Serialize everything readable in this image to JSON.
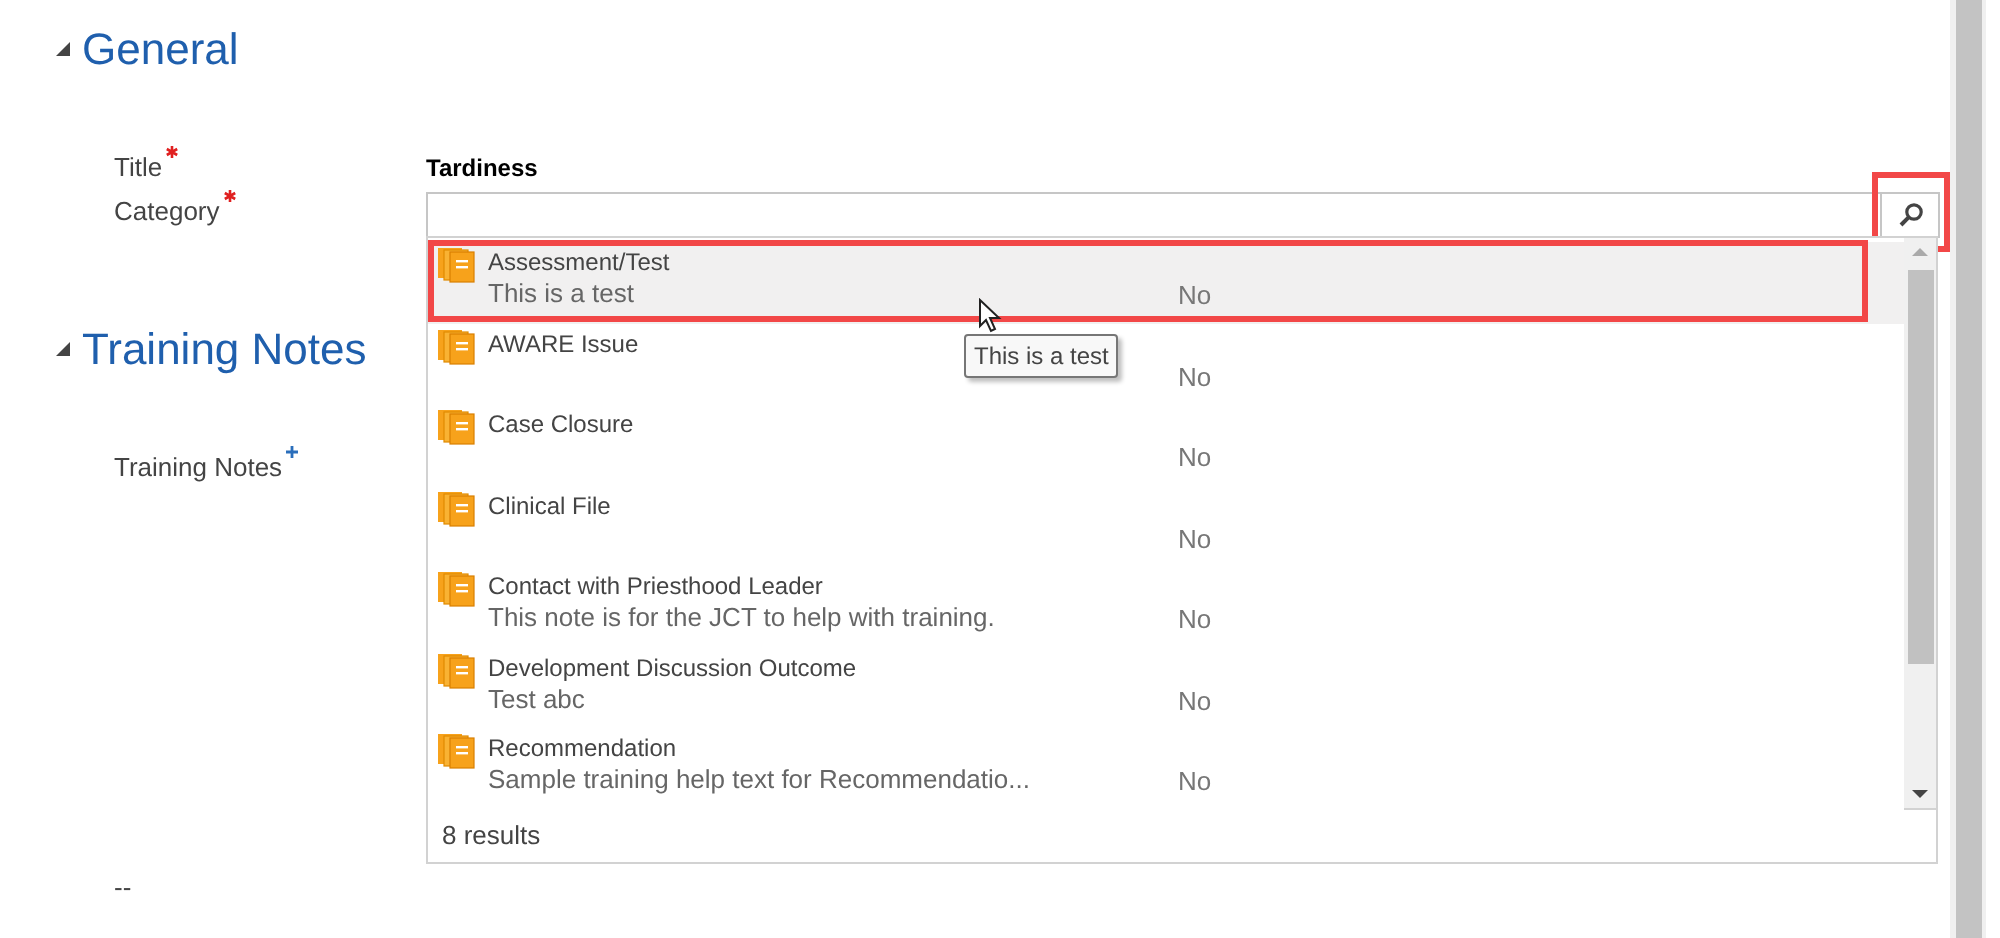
{
  "general_section": {
    "title": "General",
    "expanded": true
  },
  "fields": [
    {
      "label": "Title",
      "required": true,
      "value": "Tardiness"
    },
    {
      "label": "Category",
      "required": true
    }
  ],
  "category_lookup": {
    "search_highlighted": true,
    "results": [
      {
        "title": "Assessment/Test",
        "description": "This is a test",
        "column_2": "No",
        "selected": true,
        "highlighted": true
      },
      {
        "title": "AWARE Issue",
        "column_2": "No",
        "selected": false,
        "highlighted": false
      },
      {
        "title": "Case Closure",
        "column_2": "No",
        "selected": false,
        "highlighted": false
      },
      {
        "title": "Clinical File",
        "column_2": "No",
        "selected": false,
        "highlighted": false
      },
      {
        "title": "Contact with Priesthood Leader",
        "description": "This note is for the JCT to help with training.",
        "column_2": "No",
        "selected": false,
        "highlighted": false
      },
      {
        "title": "Development Discussion Outcome",
        "description": "Test abc",
        "column_2": "No",
        "selected": false,
        "highlighted": false
      },
      {
        "title": "Recommendation",
        "description": "Sample training help text for Recommendatio...",
        "column_2": "No",
        "selected": false,
        "highlighted": false
      }
    ],
    "result_count": "8 results",
    "tooltip": "This is a test"
  },
  "training_section": {
    "title": "Training Notes",
    "expanded": true
  },
  "training_field": {
    "label": "Training Notes",
    "recommended": true
  },
  "footer_text": "--"
}
